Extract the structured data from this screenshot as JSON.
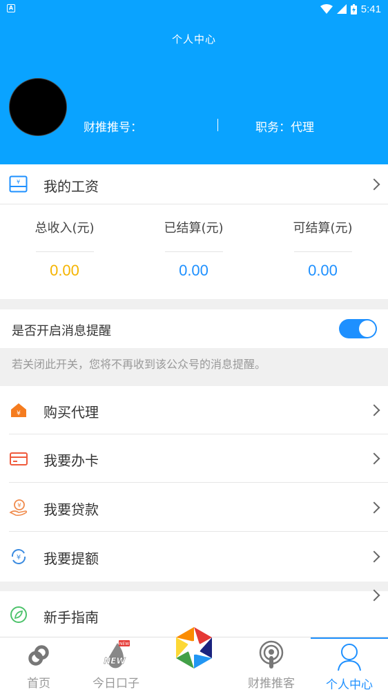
{
  "status_bar": {
    "app_badge": "A",
    "time": "5:41"
  },
  "header": {
    "title": "个人中心",
    "cai_tui_number_label": "财推推号：",
    "role_label": "职务：代理"
  },
  "salary": {
    "title": "我的工资",
    "stats": [
      {
        "label": "总收入(元)",
        "value": "0.00",
        "color": "#f5b400"
      },
      {
        "label": "已结算(元)",
        "value": "0.00",
        "color": "#1e90ff"
      },
      {
        "label": "可结算(元)",
        "value": "0.00",
        "color": "#1e90ff"
      }
    ]
  },
  "notification": {
    "label": "是否开启消息提醒",
    "enabled": true,
    "hint": "若关闭此开关，您将不再收到该公众号的消息提醒。"
  },
  "menu": [
    {
      "label": "购买代理",
      "icon": "house-icon"
    },
    {
      "label": "我要办卡",
      "icon": "card-icon"
    },
    {
      "label": "我要贷款",
      "icon": "loan-hand-icon"
    },
    {
      "label": "我要提额",
      "icon": "yuan-refresh-icon"
    }
  ],
  "guide": {
    "label": "新手指南",
    "icon": "compass-leaf-icon"
  },
  "tabs": [
    {
      "label": "首页",
      "icon": "link-icon"
    },
    {
      "label": "今日口子",
      "icon": "new-drop-icon",
      "badge": "NEW"
    },
    {
      "label": "",
      "icon": "camera-aperture-icon"
    },
    {
      "label": "财推推客",
      "icon": "podcast-icon"
    },
    {
      "label": "个人中心",
      "icon": "person-icon",
      "active": true
    }
  ]
}
